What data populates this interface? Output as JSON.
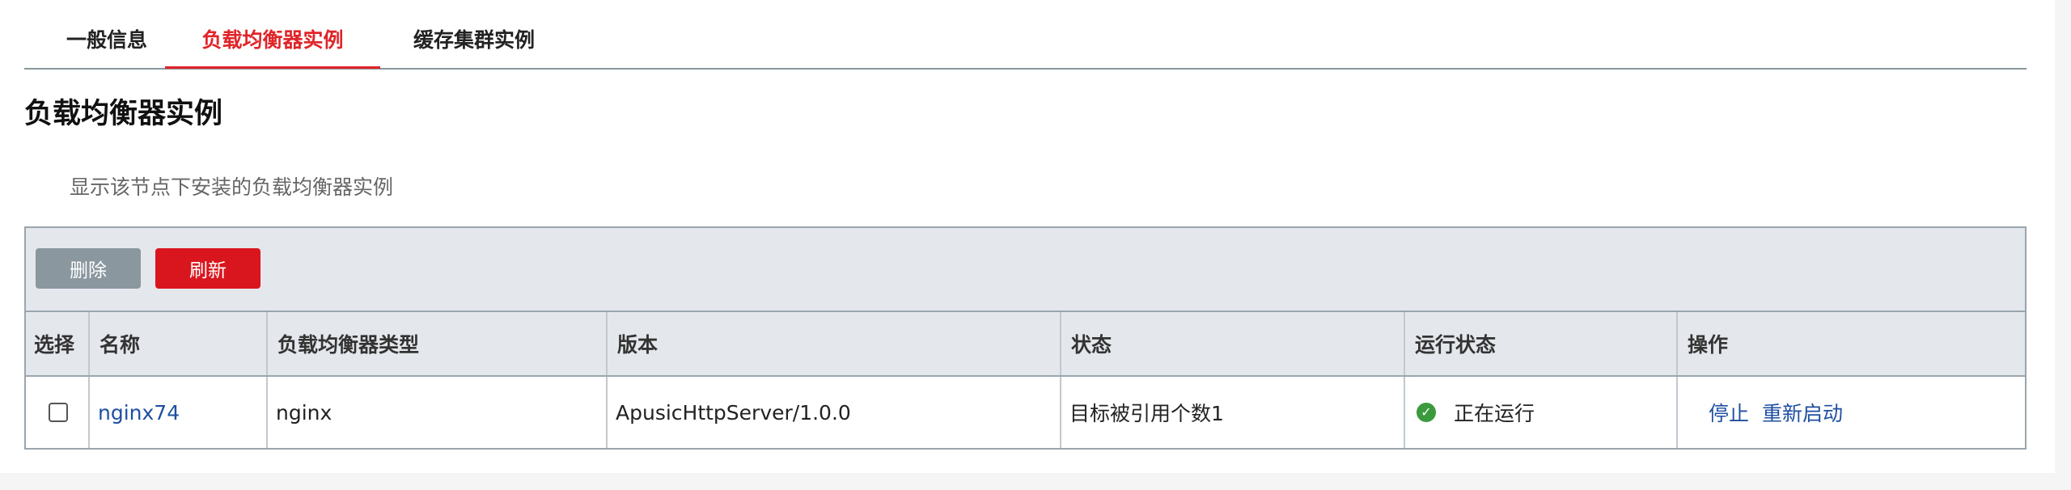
{
  "tabs": [
    {
      "label": "一般信息",
      "active": false
    },
    {
      "label": "负载均衡器实例",
      "active": true
    },
    {
      "label": "缓存集群实例",
      "active": false
    }
  ],
  "section": {
    "title": "负载均衡器实例",
    "description": "显示该节点下安装的负载均衡器实例"
  },
  "toolbar": {
    "delete_label": "删除",
    "refresh_label": "刷新"
  },
  "table": {
    "headers": [
      "选择",
      "名称",
      "负载均衡器类型",
      "版本",
      "状态",
      "运行状态",
      "操作"
    ],
    "rows": [
      {
        "selected": false,
        "name": "nginx74",
        "type": "nginx",
        "version": "ApusicHttpServer/1.0.0",
        "status": "目标被引用个数1",
        "run_status": "正在运行",
        "run_status_icon": "check-circle-icon",
        "actions": [
          "停止",
          "重新启动"
        ]
      }
    ]
  },
  "colors": {
    "accent": "#e0252a",
    "delete_button": "#8a979f",
    "refresh_button": "#d9161e",
    "link": "#1f4fa0",
    "running": "#3b9a3b"
  }
}
